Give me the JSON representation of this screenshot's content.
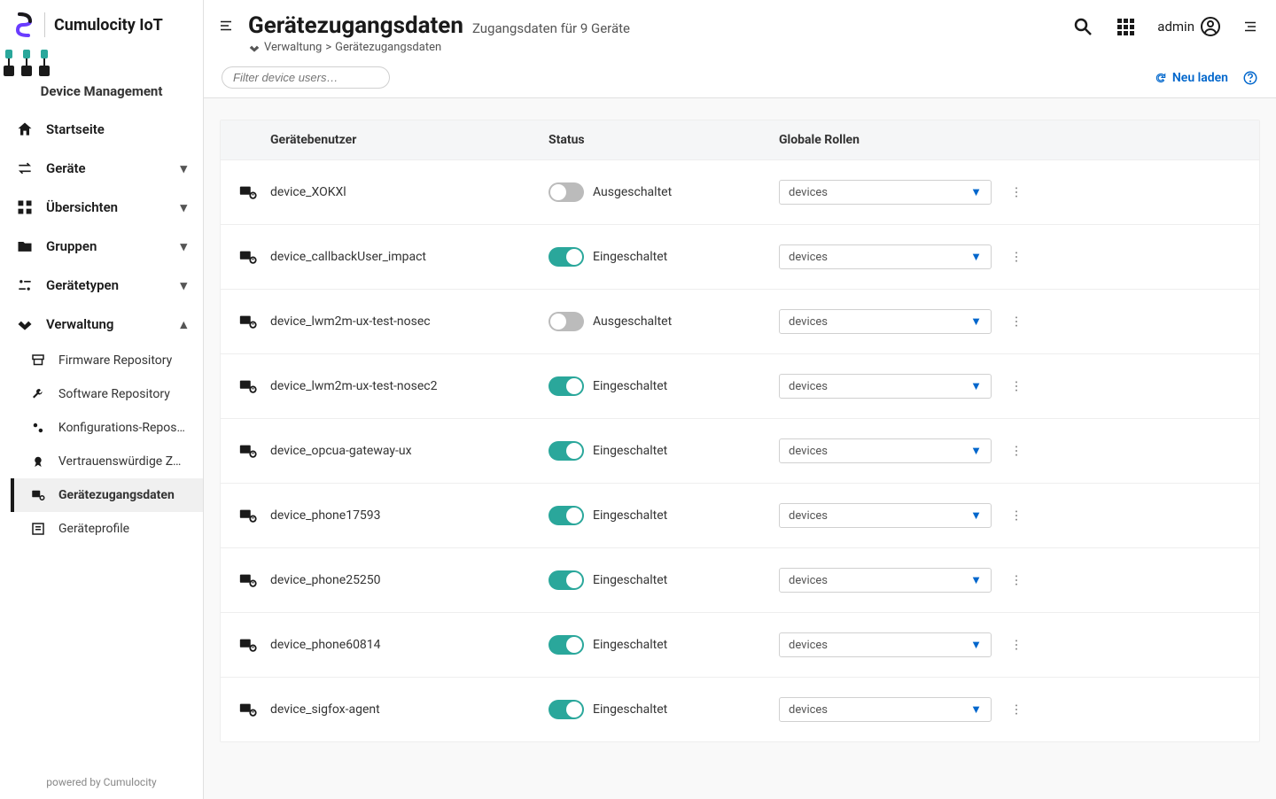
{
  "app_title": "Cumulocity IoT",
  "module_label": "Device Management",
  "nav": {
    "home": "Startseite",
    "devices": "Geräte",
    "overviews": "Übersichten",
    "groups": "Gruppen",
    "device_types": "Gerätetypen",
    "administration": "Verwaltung"
  },
  "nav_sub": {
    "firmware": "Firmware Repository",
    "software": "Software Repository",
    "config": "Konfigurations-Reposi…",
    "trusted": "Vertrauenswürdige Ze…",
    "credentials": "Gerätezugangsdaten",
    "profiles": "Geräteprofile"
  },
  "sidebar_footer": "powered by Cumulocity",
  "header": {
    "title": "Gerätezugangsdaten",
    "subtitle": "Zugangsdaten für 9 Geräte",
    "breadcrumb_root": "Verwaltung",
    "breadcrumb_sep": ">",
    "breadcrumb_current": "Gerätezugangsdaten",
    "user": "admin"
  },
  "toolbar": {
    "filter_placeholder": "Filter device users…",
    "reload": "Neu laden"
  },
  "columns": {
    "user": "Gerätebenutzer",
    "status": "Status",
    "roles": "Globale Rollen"
  },
  "status_labels": {
    "on": "Eingeschaltet",
    "off": "Ausgeschaltet"
  },
  "role_default": "devices",
  "rows": [
    {
      "name": "device_XOKXl",
      "enabled": false,
      "role": "devices"
    },
    {
      "name": "device_callbackUser_impact",
      "enabled": true,
      "role": "devices"
    },
    {
      "name": "device_lwm2m-ux-test-nosec",
      "enabled": false,
      "role": "devices"
    },
    {
      "name": "device_lwm2m-ux-test-nosec2",
      "enabled": true,
      "role": "devices"
    },
    {
      "name": "device_opcua-gateway-ux",
      "enabled": true,
      "role": "devices"
    },
    {
      "name": "device_phone17593",
      "enabled": true,
      "role": "devices"
    },
    {
      "name": "device_phone25250",
      "enabled": true,
      "role": "devices"
    },
    {
      "name": "device_phone60814",
      "enabled": true,
      "role": "devices"
    },
    {
      "name": "device_sigfox-agent",
      "enabled": true,
      "role": "devices"
    }
  ]
}
